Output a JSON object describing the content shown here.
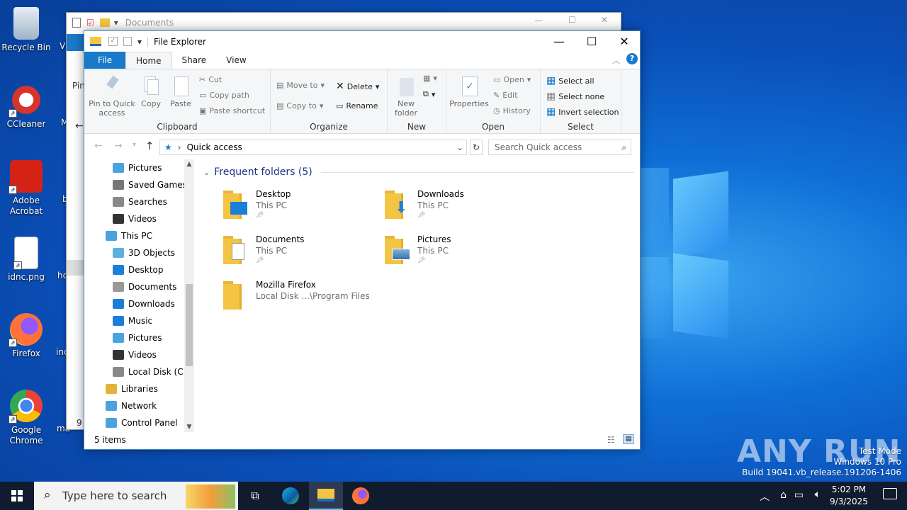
{
  "desktop": {
    "icons": [
      {
        "label": "Recycle Bin",
        "icon": "recycle-bin-icon"
      },
      {
        "label": "CCleaner",
        "icon": "ccleaner-icon"
      },
      {
        "label": "Adobe Acrobat",
        "icon": "adobe-acrobat-icon"
      },
      {
        "label": "idnc.png",
        "icon": "image-file-icon"
      },
      {
        "label": "Firefox",
        "icon": "firefox-icon"
      },
      {
        "label": "Google Chrome",
        "icon": "chrome-icon"
      }
    ],
    "partial_labels": [
      "Vi",
      "M",
      "b",
      "hc",
      "inc",
      "ma"
    ]
  },
  "background_window": {
    "title": "Documents",
    "partial_pin": "Pin",
    "partial_count": "9 i"
  },
  "explorer": {
    "title": "File Explorer",
    "tabs": [
      "File",
      "Home",
      "Share",
      "View"
    ],
    "ribbon": {
      "clipboard": {
        "label": "Clipboard",
        "pin": "Pin to Quick access",
        "copy": "Copy",
        "paste": "Paste",
        "cut": "Cut",
        "copy_path": "Copy path",
        "paste_shortcut": "Paste shortcut"
      },
      "organize": {
        "label": "Organize",
        "move_to": "Move to",
        "copy_to": "Copy to",
        "delete": "Delete",
        "rename": "Rename"
      },
      "new": {
        "label": "New",
        "new_folder": "New folder"
      },
      "open": {
        "label": "Open",
        "properties": "Properties",
        "open": "Open",
        "edit": "Edit",
        "history": "History"
      },
      "select": {
        "label": "Select",
        "select_all": "Select all",
        "select_none": "Select none",
        "invert": "Invert selection"
      }
    },
    "address": {
      "path": "Quick access",
      "search_placeholder": "Search Quick access"
    },
    "nav": [
      {
        "label": "Pictures",
        "icon": "pictures-icon",
        "indent": 1
      },
      {
        "label": "Saved Games",
        "icon": "saved-games-icon",
        "indent": 1
      },
      {
        "label": "Searches",
        "icon": "search-icon",
        "indent": 1
      },
      {
        "label": "Videos",
        "icon": "videos-icon",
        "indent": 1
      },
      {
        "label": "This PC",
        "icon": "computer-icon",
        "indent": 0
      },
      {
        "label": "3D Objects",
        "icon": "3d-objects-icon",
        "indent": 1
      },
      {
        "label": "Desktop",
        "icon": "desktop-icon",
        "indent": 1
      },
      {
        "label": "Documents",
        "icon": "documents-icon",
        "indent": 1
      },
      {
        "label": "Downloads",
        "icon": "downloads-icon",
        "indent": 1
      },
      {
        "label": "Music",
        "icon": "music-icon",
        "indent": 1
      },
      {
        "label": "Pictures",
        "icon": "pictures-icon",
        "indent": 1
      },
      {
        "label": "Videos",
        "icon": "videos-icon",
        "indent": 1
      },
      {
        "label": "Local Disk (C:)",
        "icon": "disk-icon",
        "indent": 1
      },
      {
        "label": "Libraries",
        "icon": "libraries-icon",
        "indent": 0
      },
      {
        "label": "Network",
        "icon": "network-icon",
        "indent": 0
      },
      {
        "label": "Control Panel",
        "icon": "control-panel-icon",
        "indent": 0
      }
    ],
    "section_title": "Frequent folders (5)",
    "folders": [
      {
        "name": "Desktop",
        "location": "This PC",
        "pinned": true,
        "overlay": "desktop"
      },
      {
        "name": "Downloads",
        "location": "This PC",
        "pinned": true,
        "overlay": "download"
      },
      {
        "name": "Documents",
        "location": "This PC",
        "pinned": true,
        "overlay": "document"
      },
      {
        "name": "Pictures",
        "location": "This PC",
        "pinned": true,
        "overlay": "picture"
      },
      {
        "name": "Mozilla Firefox",
        "location": "Local Disk ...\\Program Files",
        "pinned": false,
        "overlay": "none"
      }
    ],
    "status": "5 items"
  },
  "taskbar": {
    "search_placeholder": "Type here to search",
    "time": "5:02 PM",
    "date": "9/3/2025"
  },
  "watermark": {
    "line1": "Test Mode",
    "line2": "Windows 10 Pro",
    "line3": "Build 19041.vb_release.191206-1406",
    "brand": "ANY RUN"
  },
  "colors": {
    "accent": "#1979ca",
    "taskbar": "#101c2e",
    "folder": "#f4c542"
  }
}
